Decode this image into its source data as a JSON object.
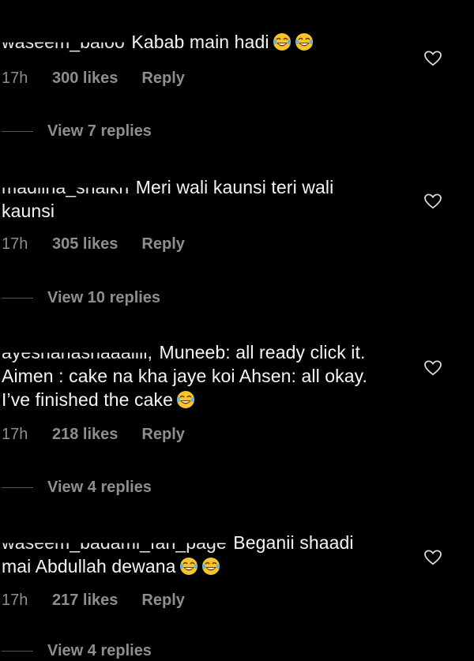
{
  "comments": [
    {
      "username": "waseem_baloo",
      "text": "Kabab main hadi",
      "emojis": 2,
      "time": "17h",
      "likes": "300 likes",
      "reply": "Reply",
      "view_replies": "View 7 replies"
    },
    {
      "username": "madiiha_shaikh",
      "text": "Meri wali kaunsi teri wali kaunsi",
      "emojis": 0,
      "time": "17h",
      "likes": "305 likes",
      "reply": "Reply",
      "view_replies": "View 10 replies"
    },
    {
      "username": "ayeshahashaaaliii,",
      "text": "Muneeb: all ready click it. Aimen : cake na kha jaye koi Ahsen: all okay. I’ve finished the cake",
      "emojis": 1,
      "time": "17h",
      "likes": "218 likes",
      "reply": "Reply",
      "view_replies": "View 4 replies"
    },
    {
      "username": "waseem_badami_fan_page",
      "text": "Beganii shaadi mai Abdullah dewana",
      "emojis": 2,
      "time": "17h",
      "likes": "217 likes",
      "reply": "Reply",
      "view_replies": "View 4 replies"
    }
  ],
  "icons": {
    "like": "heart-outline-icon",
    "emoji": "face-with-tears-of-joy-icon"
  },
  "colors": {
    "background": "#000000",
    "text": "#f5f5f5",
    "muted": "#8e8e8e",
    "emoji": "#f7c52b"
  }
}
